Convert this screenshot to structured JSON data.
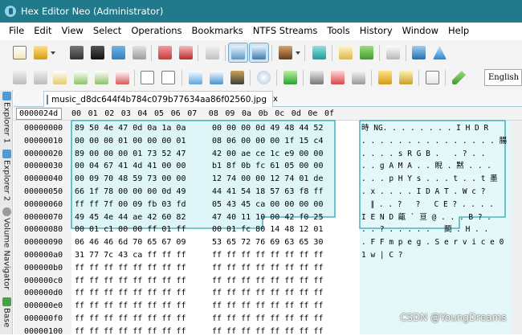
{
  "window": {
    "title": "Hex Editor Neo (Administrator)"
  },
  "menu": [
    "File",
    "Edit",
    "View",
    "Select",
    "Operations",
    "Bookmarks",
    "NTFS Streams",
    "Tools",
    "History",
    "Window",
    "Help"
  ],
  "toolbar1": {
    "icons": [
      "new-file-icon",
      "open-file-icon",
      "save-icon",
      "save-all-icon",
      "save-as-icon",
      "print-icon",
      "close-icon",
      "close-all-icon",
      "refresh-icon",
      "view-toggle-a-icon",
      "view-toggle-b-icon",
      "tools-icon",
      "monitor-icon",
      "mail-icon",
      "users-icon",
      "window-icon",
      "help-icon",
      "warning-icon"
    ]
  },
  "toolbar2": {
    "icons": [
      "undo-icon",
      "redo-icon",
      "edit-icon",
      "copy-icon",
      "paste-icon",
      "delete-icon",
      "document-icon",
      "document-plus-icon",
      "document-arrow-icon",
      "export-icon",
      "import-icon",
      "camera-icon",
      "find-icon",
      "tree-icon",
      "highlight-icon",
      "chart-icon",
      "lock-icon",
      "unlock-icon",
      "binary-icon",
      "pen-icon"
    ],
    "language": "English"
  },
  "side_tabs": [
    {
      "label": "Explorer 1"
    },
    {
      "label": "Explorer 2"
    },
    {
      "label": "Volume Navigator"
    },
    {
      "label": "Base"
    }
  ],
  "file_tab": {
    "name": "music_d8dc644f4b784c079b77634aa86f02560.jpg",
    "close": "x"
  },
  "header_offset": "0000024d",
  "columns": [
    "00",
    "01",
    "02",
    "03",
    "04",
    "05",
    "06",
    "07",
    "08",
    "09",
    "0a",
    "0b",
    "0c",
    "0d",
    "0e",
    "0f"
  ],
  "offsets": [
    "00000000",
    "00000010",
    "00000020",
    "00000030",
    "00000040",
    "00000050",
    "00000060",
    "00000070",
    "00000080",
    "00000090",
    "000000a0",
    "000000b0",
    "000000c0",
    "000000d0",
    "000000e0",
    "000000f0",
    "00000100"
  ],
  "rows": [
    {
      "a": "89 50 4e 47 0d 0a 1a 0a",
      "b": "00 00 00 0d 49 48 44 52",
      "t": "時 NG. . . . . . . . I H D R"
    },
    {
      "a": "00 00 00 01 00 00 00 01",
      "b": "08 06 00 00 00 1f 15 c4",
      "t": ". . . . . . . . . . . . . . . 腸"
    },
    {
      "a": "89 00 00 00 01 73 52 47",
      "b": "42 00 ae ce 1c e9 00 00",
      "t": ". . . . s R G B .   . ? . ."
    },
    {
      "a": "00 04 67 41 4d 41 00 00",
      "b": "b1 8f 0b fc 61 05 00 00",
      "t": ". . g A M A . . 睨 . 黙 . . ."
    },
    {
      "a": "00 09 70 48 59 73 00 00",
      "b": "12 74 00 00 12 74 01 de",
      "t": ". . . p H Y s . . . t . . t 墨"
    },
    {
      "a": "66 1f 78 00 00 00 0d 49",
      "b": "44 41 54 18 57 63 f8 ff",
      "t": ". x . . . . I D A T . W c ? "
    },
    {
      "a": "ff ff 7f 00 09 fb 03 fd",
      "b": "05 43 45 ca 00 00 00 00",
      "t": "  ∥ . . ?   ?   C E ? . . . ."
    },
    {
      "a": "49 45 4e 44 ae 42 60 82",
      "b": "47 40 11 10 00 42 f0 25",
      "t": "I E N D 甂 ` 亘 @ . . . B ? ."
    },
    {
      "a": "00 01 c1 00 00 ff 01 ff",
      "b": "00 01 fc 80 14 48 12 01",
      "t": ". . ? . . . . .   鬬 . H . ."
    },
    {
      "a": "06 46 46 6d 70 65 67 09",
      "b": "53 65 72 76 69 63 65 30",
      "t": ". F F m p e g . S e r v i c e 0"
    },
    {
      "a": "31 77 7c 43 ca ff ff ff",
      "b": "ff ff ff ff ff ff ff ff",
      "t": "1 w | C ?"
    },
    {
      "a": "ff ff ff ff ff ff ff ff",
      "b": "ff ff ff ff ff ff ff ff",
      "t": ""
    },
    {
      "a": "ff ff ff ff ff ff ff ff",
      "b": "ff ff ff ff ff ff ff ff",
      "t": ""
    },
    {
      "a": "ff ff ff ff ff ff ff ff",
      "b": "ff ff ff ff ff ff ff ff",
      "t": ""
    },
    {
      "a": "ff ff ff ff ff ff ff ff",
      "b": "ff ff ff ff ff ff ff ff",
      "t": ""
    },
    {
      "a": "ff ff ff ff ff ff ff ff",
      "b": "ff ff ff ff ff ff ff ff",
      "t": ""
    },
    {
      "a": "ff ff ff ff ff ff ff ff",
      "b": "ff ff ff ff ff ff ff ff",
      "t": ""
    }
  ],
  "watermark": "CSDN @YoungDreams",
  "colors": {
    "titlebar": "#217a8c",
    "selection": "#ddf5f7",
    "selection_border": "#2aa6b4"
  }
}
